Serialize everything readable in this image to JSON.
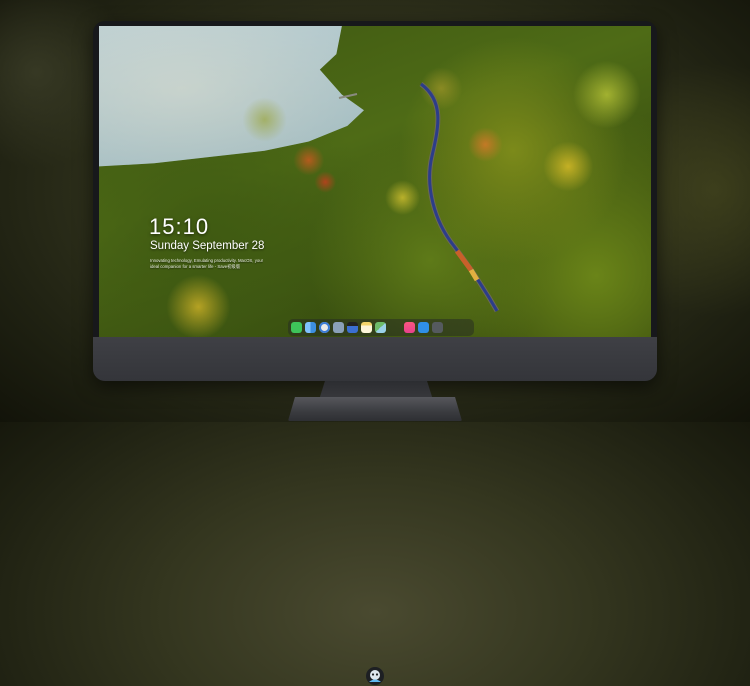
{
  "lock_screen": {
    "time": "15:10",
    "date": "Sunday September 28",
    "tagline": "Innovating technology, Emulating productivity. MacOS, your ideal companion for a smarter life - Save初级版"
  },
  "dock": {
    "items": [
      {
        "name": "messages-icon",
        "color": "#3ec45a"
      },
      {
        "name": "finder-icon",
        "color": "#3d8fe0"
      },
      {
        "name": "safari-icon",
        "color": "#e8e8e8"
      },
      {
        "name": "preview-icon",
        "color": "#8aa0b8"
      },
      {
        "name": "clapper-icon",
        "color": "#3b6fd1"
      },
      {
        "name": "notes-icon",
        "color": "#f3d56a"
      },
      {
        "name": "maps-icon",
        "color": "#6dbb6a"
      },
      {
        "name": "music-icon",
        "color": "#e8418d"
      },
      {
        "name": "app-store-icon",
        "color": "#2f8fe6"
      },
      {
        "name": "camera-icon",
        "color": "#555a5f"
      }
    ]
  },
  "bezel": {
    "logo": "avatar-logo-icon"
  },
  "colors": {
    "bezel": "#3a3b40",
    "background": "#34361f"
  }
}
